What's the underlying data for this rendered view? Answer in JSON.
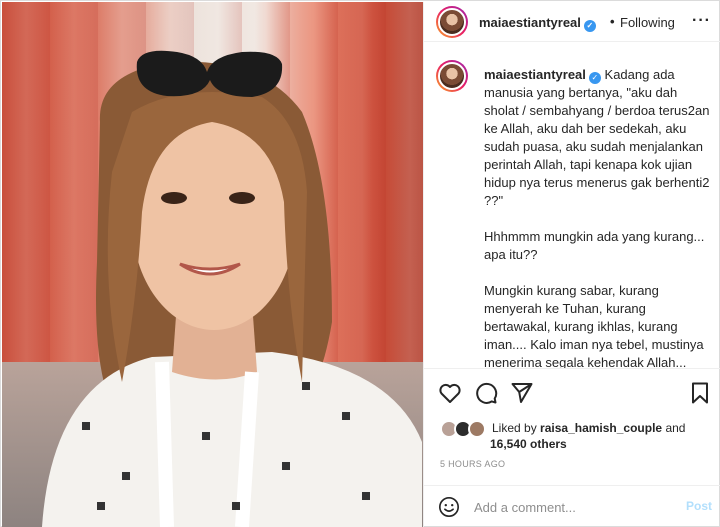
{
  "post": {
    "username": "maiaestiantyreal",
    "follow_separator": "•",
    "follow_status": "Following",
    "more_label": "···"
  },
  "caption": {
    "username": "maiaestiantyreal",
    "text": "Kadang ada manusia yang bertanya, \"aku dah sholat / sembahyang / berdoa terus2an ke Allah, aku dah ber sedekah, aku sudah puasa, aku sudah menjalankan perintah Allah, tapi kenapa kok ujian hidup nya terus menerus gak berhenti2 ??\"\n\nHhhmmm mungkin ada yang kurang... apa itu??\n\nMungkin kurang sabar, kurang menyerah ke Tuhan, kurang bertawakal, kurang ikhlas, kurang iman.... Kalo iman nya tebel, mustinya menerima segala kehendak Allah... mungkin juga masih terlalu terikat dengan dunia... (anak, pasangan,"
  },
  "actions": {
    "like_icon": "heart-icon",
    "comment_icon": "comment-icon",
    "share_icon": "paper-plane-icon",
    "save_icon": "bookmark-icon"
  },
  "likes": {
    "prefix": "Liked by",
    "liked_by_user": "raisa_hamish_couple",
    "conjunction": "and",
    "others": "16,540 others"
  },
  "timestamp": "5 HOURS AGO",
  "comment_box": {
    "placeholder": "Add a comment...",
    "post_label": "Post",
    "emoji_icon": "smiley-icon"
  },
  "colors": {
    "verified_badge": "#3897f0",
    "post_disabled": "#b2dffc"
  }
}
